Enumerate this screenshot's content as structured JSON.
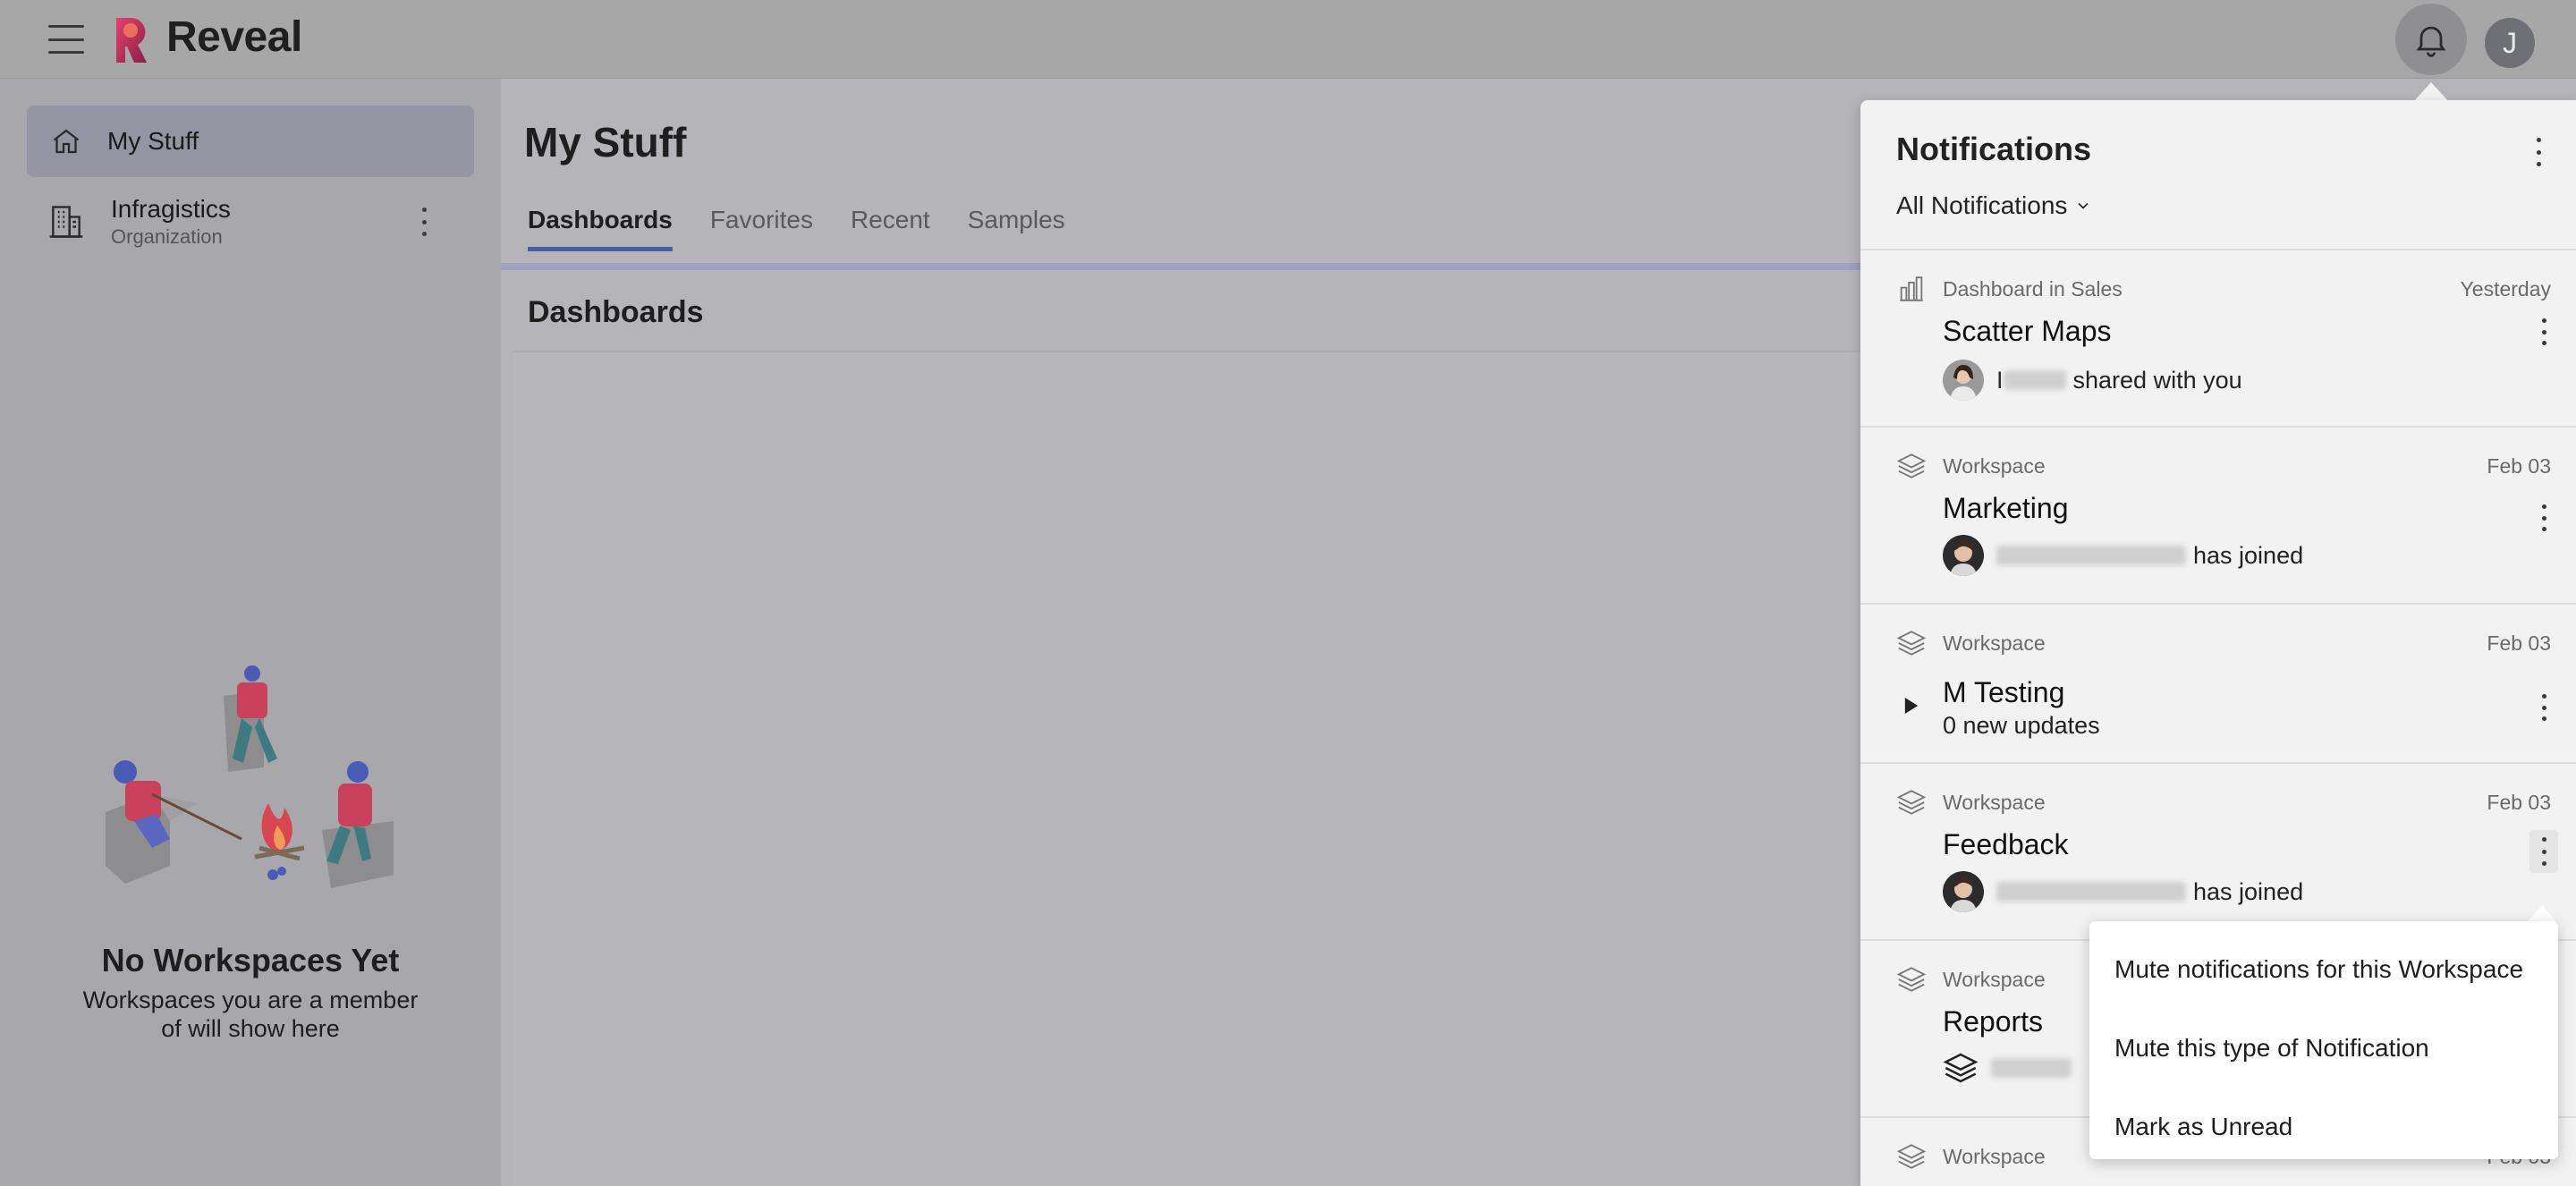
{
  "app": {
    "brand": "Reveal",
    "user_initial": "J",
    "accent_color": "#4c5aa5"
  },
  "sidebar": {
    "items": [
      {
        "label": "My Stuff",
        "icon": "home-icon"
      },
      {
        "label": "Infragistics",
        "sublabel": "Organization",
        "icon": "building-icon"
      }
    ],
    "empty_title": "No Workspaces Yet",
    "empty_text_line1": "Workspaces you are a member",
    "empty_text_line2": "of will show here"
  },
  "main": {
    "title": "My Stuff",
    "tabs": [
      "Dashboards",
      "Favorites",
      "Recent",
      "Samples"
    ],
    "active_tab": "Dashboards",
    "section_title": "Dashboards"
  },
  "notifications": {
    "title": "Notifications",
    "filter": "All Notifications",
    "items": [
      {
        "category": "Dashboard in Sales",
        "date": "Yesterday",
        "title": "Scatter Maps",
        "text": "shared with you",
        "name_initial": "I"
      },
      {
        "category": "Workspace",
        "date": "Feb 03",
        "title": "Marketing",
        "text": "has joined"
      },
      {
        "category": "Workspace",
        "date": "Feb 03",
        "title": "M Testing",
        "text": "0 new updates"
      },
      {
        "category": "Workspace",
        "date": "Feb 03",
        "title": "Feedback",
        "text": "has joined"
      },
      {
        "category": "Workspace",
        "date": "",
        "title": "Reports",
        "text": ""
      },
      {
        "category": "Workspace",
        "date": "Feb 03",
        "title": "",
        "text": ""
      }
    ]
  },
  "context_menu": {
    "items": [
      "Mute notifications for this Workspace",
      "Mute this type of Notification",
      "Mark as Unread"
    ]
  }
}
